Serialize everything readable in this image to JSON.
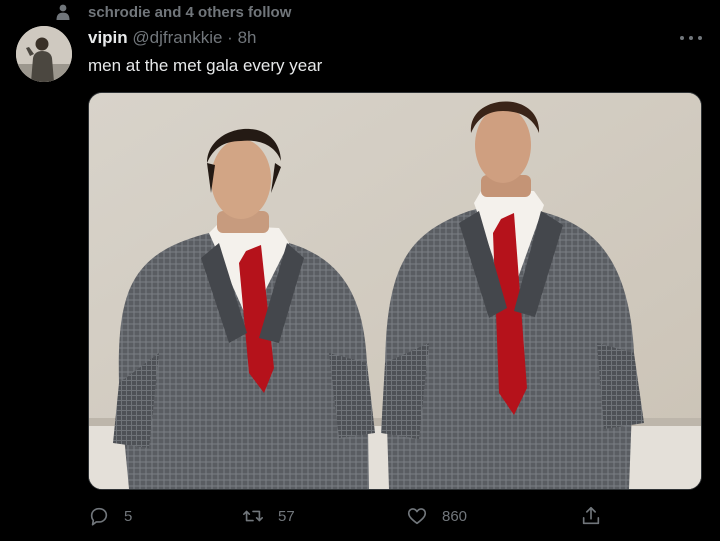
{
  "social_context": {
    "text": "schrodie and 4 others follow",
    "icon": "person-icon"
  },
  "tweet": {
    "author_name": "vipin",
    "author_handle": "@djfrankkie",
    "separator": "·",
    "time": "8h",
    "text": "men at the met gala every year",
    "media_description": "photo",
    "menu_icon": "more-icon"
  },
  "actions": {
    "reply": {
      "icon": "reply-icon",
      "count": "5"
    },
    "retweet": {
      "icon": "retweet-icon",
      "count": "57"
    },
    "like": {
      "icon": "like-icon",
      "count": "860"
    },
    "share": {
      "icon": "share-icon"
    }
  },
  "colors": {
    "background": "#000000",
    "primary_text": "#e7e9ea",
    "secondary_text": "#71767b",
    "tie_red": "#b5121b"
  }
}
